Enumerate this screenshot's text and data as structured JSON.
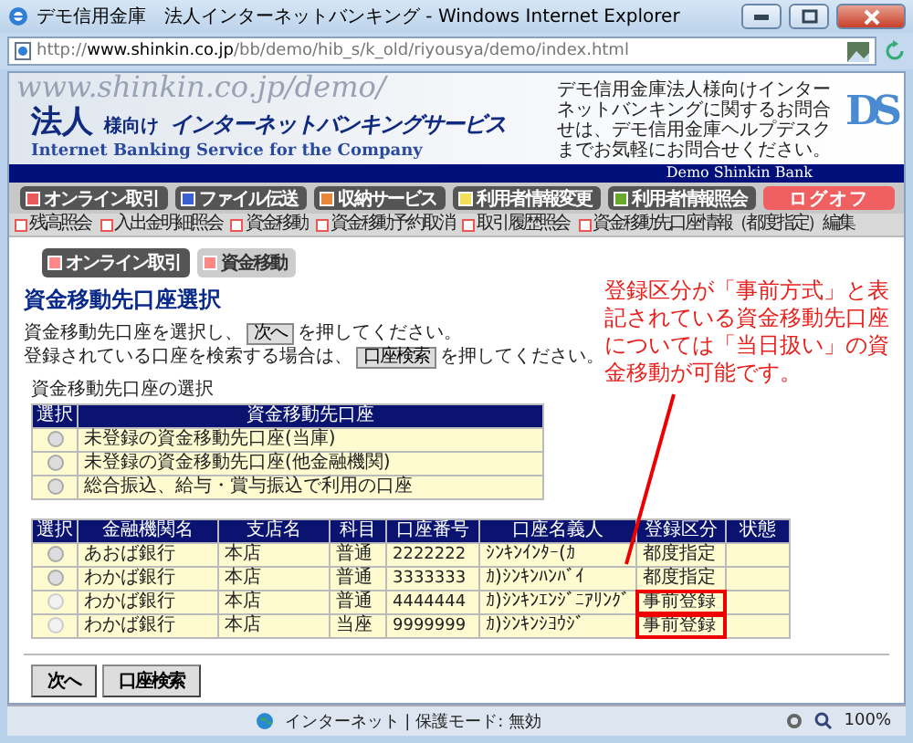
{
  "window": {
    "title": "デモ信用金庫　法人インターネットバンキング - Windows Internet Explorer",
    "url": "http://**www.shinkin.co.jp**/bb/demo/hib_s/k_old/riyousya/demo/index.html"
  },
  "banner": {
    "watermark": "www.shinkin.co.jp/demo/",
    "title_main": "法人",
    "title_small": "様向け",
    "title": "インターネットバンキングサービス",
    "subtitle": "Internet Banking Service for the Company",
    "help": "デモ信用金庫法人様向けインターネットバンキングに関するお問合せは、デモ信用金庫ヘルプデスクまでお気軽にお問合せください。",
    "logo": "DS",
    "bank": "Demo Shinkin Bank"
  },
  "main_nav": [
    {
      "label": "オンライン取引",
      "color": "#e85a5a",
      "kind": "menu"
    },
    {
      "label": "ファイル伝送",
      "color": "#3a5fd0",
      "kind": "menu"
    },
    {
      "label": "収納サービス",
      "color": "#e8873a",
      "kind": "menu"
    },
    {
      "label": "利用者情報変更",
      "color": "#f2e05a",
      "kind": "menu"
    },
    {
      "label": "利用者情報照会",
      "color": "#6aa82a",
      "kind": "menu"
    },
    {
      "label": "ログオフ",
      "color": "#f06060",
      "kind": "logoff"
    }
  ],
  "sub_nav": [
    "残高照会",
    "入出金明細照会",
    "資金移動",
    "資金移動予約取消",
    "取引履歴照会",
    "資金移動先口座情報（都度指定）編集"
  ],
  "breadcrumb": [
    {
      "label": "オンライン取引",
      "kind": "parent"
    },
    {
      "label": "資金移動",
      "kind": "current"
    }
  ],
  "heading": "資金移動先口座選択",
  "instructions": [
    {
      "before": "資金移動先口座を選択し、",
      "button": "次へ",
      "after": "を押してください。"
    },
    {
      "before": "登録されている口座を検索する場合は、",
      "button": "口座検索",
      "after": "を押してください。"
    }
  ],
  "section_label": "資金移動先口座の選択",
  "account_type_table": {
    "columns": [
      "選択",
      "資金移動先口座"
    ],
    "rows": [
      {
        "label": "未登録の資金移動先口座(当庫)",
        "selected": false
      },
      {
        "label": "未登録の資金移動先口座(他金融機関)",
        "selected": false
      },
      {
        "label": "総合振込、給与・賞与振込で利用の口座",
        "selected": false
      }
    ]
  },
  "accounts_table": {
    "select_header": "選択",
    "columns": [
      "金融機関名",
      "支店名",
      "科目",
      "口座番号",
      "口座名義人",
      "登録区分",
      "状態"
    ],
    "rows": [
      {
        "selected": false,
        "disabled": false,
        "highlighted": false,
        "cells": [
          "あおば銀行",
          "本店",
          "普通",
          "2222222",
          "ｼﾝｷﾝｲﾝﾀｰ(ｶ",
          "都度指定",
          ""
        ]
      },
      {
        "selected": false,
        "disabled": false,
        "highlighted": false,
        "cells": [
          "わかば銀行",
          "本店",
          "普通",
          "3333333",
          "ｶ)ｼﾝｷﾝﾊﾝﾊﾞｲ",
          "都度指定",
          ""
        ]
      },
      {
        "selected": false,
        "disabled": true,
        "highlighted": true,
        "cells": [
          "わかば銀行",
          "本店",
          "普通",
          "4444444",
          "ｶ)ｼﾝｷﾝｴﾝｼﾞﾆｱﾘﾝｸﾞ",
          "事前登録",
          ""
        ]
      },
      {
        "selected": false,
        "disabled": true,
        "highlighted": true,
        "cells": [
          "わかば銀行",
          "本店",
          "当座",
          "9999999",
          "ｶ)ｼﾝｷﾝｼﾖｳｼﾞ",
          "事前登録",
          ""
        ]
      }
    ]
  },
  "buttons": [
    "次へ",
    "口座検索"
  ],
  "annotation": "登録区分が「事前方式」と表記されている資金移動先口座については「当日扱い」の資金移動が可能です。",
  "status_bar": {
    "zone": "インターネット | 保護モード: 無効",
    "zoom": "100%"
  }
}
